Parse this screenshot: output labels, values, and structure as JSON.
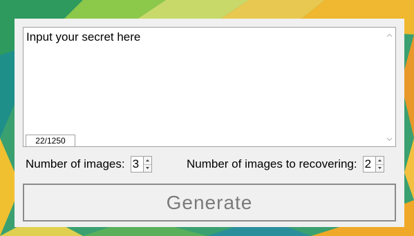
{
  "secret_input": {
    "value": "Input your secret here",
    "counter": "22/1250"
  },
  "settings": {
    "images_label": "Number of images:",
    "images_value": "3",
    "recover_label": "Number of images to recovering:",
    "recover_value": "2"
  },
  "generate": {
    "label": "Generate"
  },
  "colors": {
    "panel": "#f0f0f0",
    "border": "#a0a0a0",
    "generate_text": "#7a7a7a"
  }
}
